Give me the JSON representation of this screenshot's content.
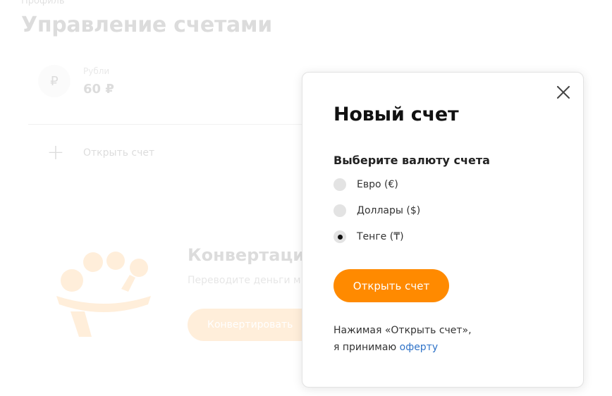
{
  "background": {
    "breadcrumb": "Профиль",
    "title": "Управление счетами",
    "account": {
      "currency_symbol": "₽",
      "name": "Рубли",
      "balance": "60 ₽"
    },
    "open_account_label": "Открыть счет",
    "promo": {
      "title": "Конвертация",
      "description": "Переводите деньги м",
      "button_label": "Конвертировать"
    }
  },
  "modal": {
    "title": "Новый счет",
    "section_label": "Выберите валюту счета",
    "options": [
      {
        "label": "Евро (€)",
        "selected": false
      },
      {
        "label": "Доллары ($)",
        "selected": false
      },
      {
        "label": "Тенге (₸)",
        "selected": true
      }
    ],
    "submit_label": "Открыть счет",
    "terms_text_1": "Нажимая «Открыть счет»,",
    "terms_text_2": "я принимаю",
    "terms_link": "оферту"
  },
  "colors": {
    "accent": "#ff8a00",
    "link": "#2f73c8"
  },
  "icons": [
    "close-icon",
    "plus-icon",
    "currency-exchange-illustration"
  ]
}
